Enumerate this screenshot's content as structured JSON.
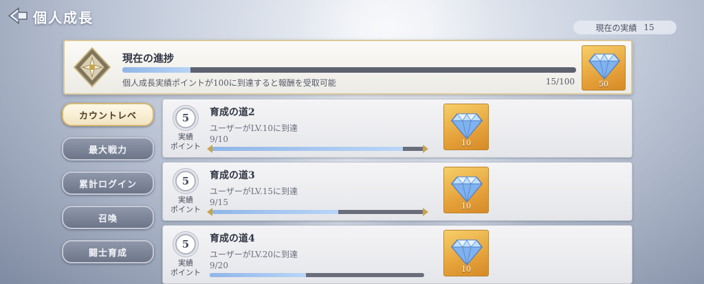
{
  "header": {
    "title": "個人成長",
    "back_icon": "back-arrow-icon"
  },
  "achievement": {
    "label": "現在の実績",
    "value": "15"
  },
  "progress": {
    "title": "現在の進捗",
    "description": "個人成長実績ポイントが100に到達すると報酬を受取可能",
    "count": "15/100",
    "fraction": 0.15,
    "reward_qty": "50",
    "reward_icon": "diamond-icon"
  },
  "tabs": [
    {
      "label": "アカウントレベル",
      "display": "カウントレベ",
      "active": true
    },
    {
      "label": "最大戦力",
      "display": "最大戦力",
      "active": false
    },
    {
      "label": "累計ログイン",
      "display": "累計ログイン",
      "active": false
    },
    {
      "label": "召喚",
      "display": "召喚",
      "active": false
    },
    {
      "label": "闘士育成",
      "display": "闘士育成",
      "active": false
    }
  ],
  "tasks": [
    {
      "points": "5",
      "points_label_1": "実績",
      "points_label_2": "ポイント",
      "title": "育成の道2",
      "description": "ユーザーがLV.10に到達",
      "count": "9/10",
      "fraction": 0.9,
      "reward_qty": "10"
    },
    {
      "points": "5",
      "points_label_1": "実績",
      "points_label_2": "ポイント",
      "title": "育成の道3",
      "description": "ユーザーがLV.15に到達",
      "count": "9/15",
      "fraction": 0.6,
      "reward_qty": "10"
    },
    {
      "points": "5",
      "points_label_1": "実績",
      "points_label_2": "ポイント",
      "title": "育成の道4",
      "description": "ユーザーがLV.20に到達",
      "count": "9/20",
      "fraction": 0.45,
      "reward_qty": "10"
    }
  ],
  "colors": {
    "accent_gold": "#e6a23a",
    "progress_blue": "#8fb6e8",
    "tab_active": "#f1e4c2"
  }
}
